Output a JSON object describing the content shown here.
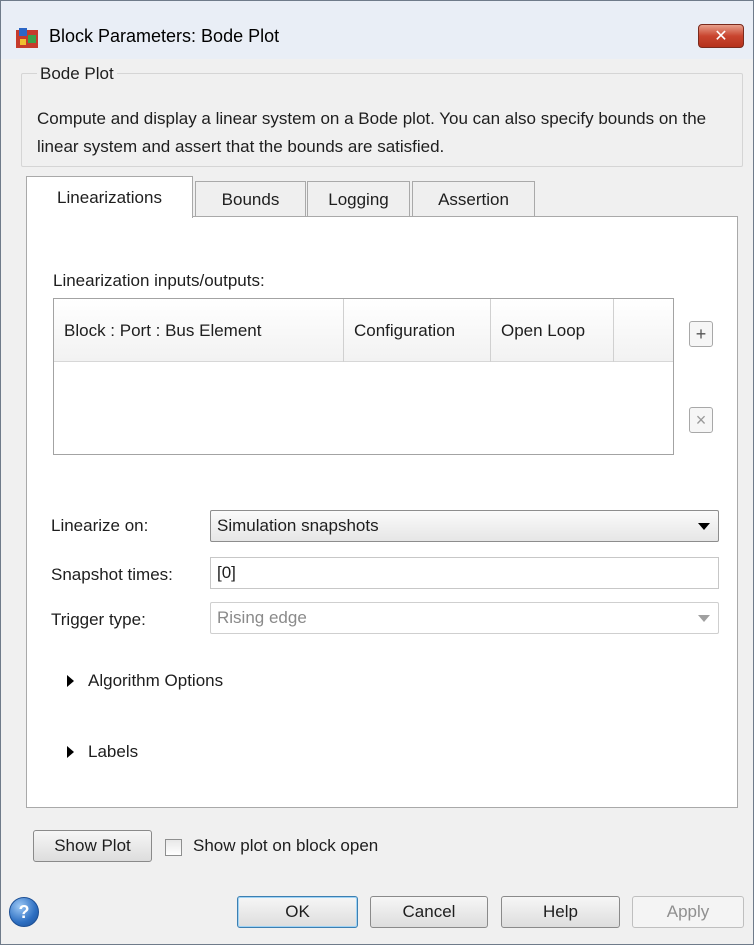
{
  "window": {
    "title": "Block Parameters: Bode Plot",
    "close_glyph": "✕"
  },
  "description": {
    "group_title": "Bode Plot",
    "text": "Compute and display a linear system on a Bode plot. You can also specify bounds on the linear system and assert that the bounds are satisfied."
  },
  "tabs": [
    {
      "label": "Linearizations",
      "active": true
    },
    {
      "label": "Bounds",
      "active": false
    },
    {
      "label": "Logging",
      "active": false
    },
    {
      "label": "Assertion",
      "active": false
    }
  ],
  "linearizations": {
    "io_label": "Linearization inputs/outputs:",
    "table": {
      "columns": [
        "Block : Port : Bus Element",
        "Configuration",
        "Open Loop"
      ],
      "rows": []
    },
    "add_glyph": "+",
    "remove_glyph": "×",
    "linearize_on": {
      "label": "Linearize on:",
      "value": "Simulation snapshots"
    },
    "snapshot_times": {
      "label": "Snapshot times:",
      "value": "[0]"
    },
    "trigger_type": {
      "label": "Trigger type:",
      "value": "Rising edge",
      "disabled": true
    },
    "algorithm_options": "Algorithm Options",
    "labels": "Labels"
  },
  "bottom": {
    "show_plot": "Show Plot",
    "show_on_open_label": "Show plot on block open",
    "show_on_open_checked": false,
    "help_glyph": "?",
    "ok": "OK",
    "cancel": "Cancel",
    "help": "Help",
    "apply": "Apply"
  },
  "icons": {
    "app": "simulink-block-icon",
    "help": "help-icon"
  }
}
